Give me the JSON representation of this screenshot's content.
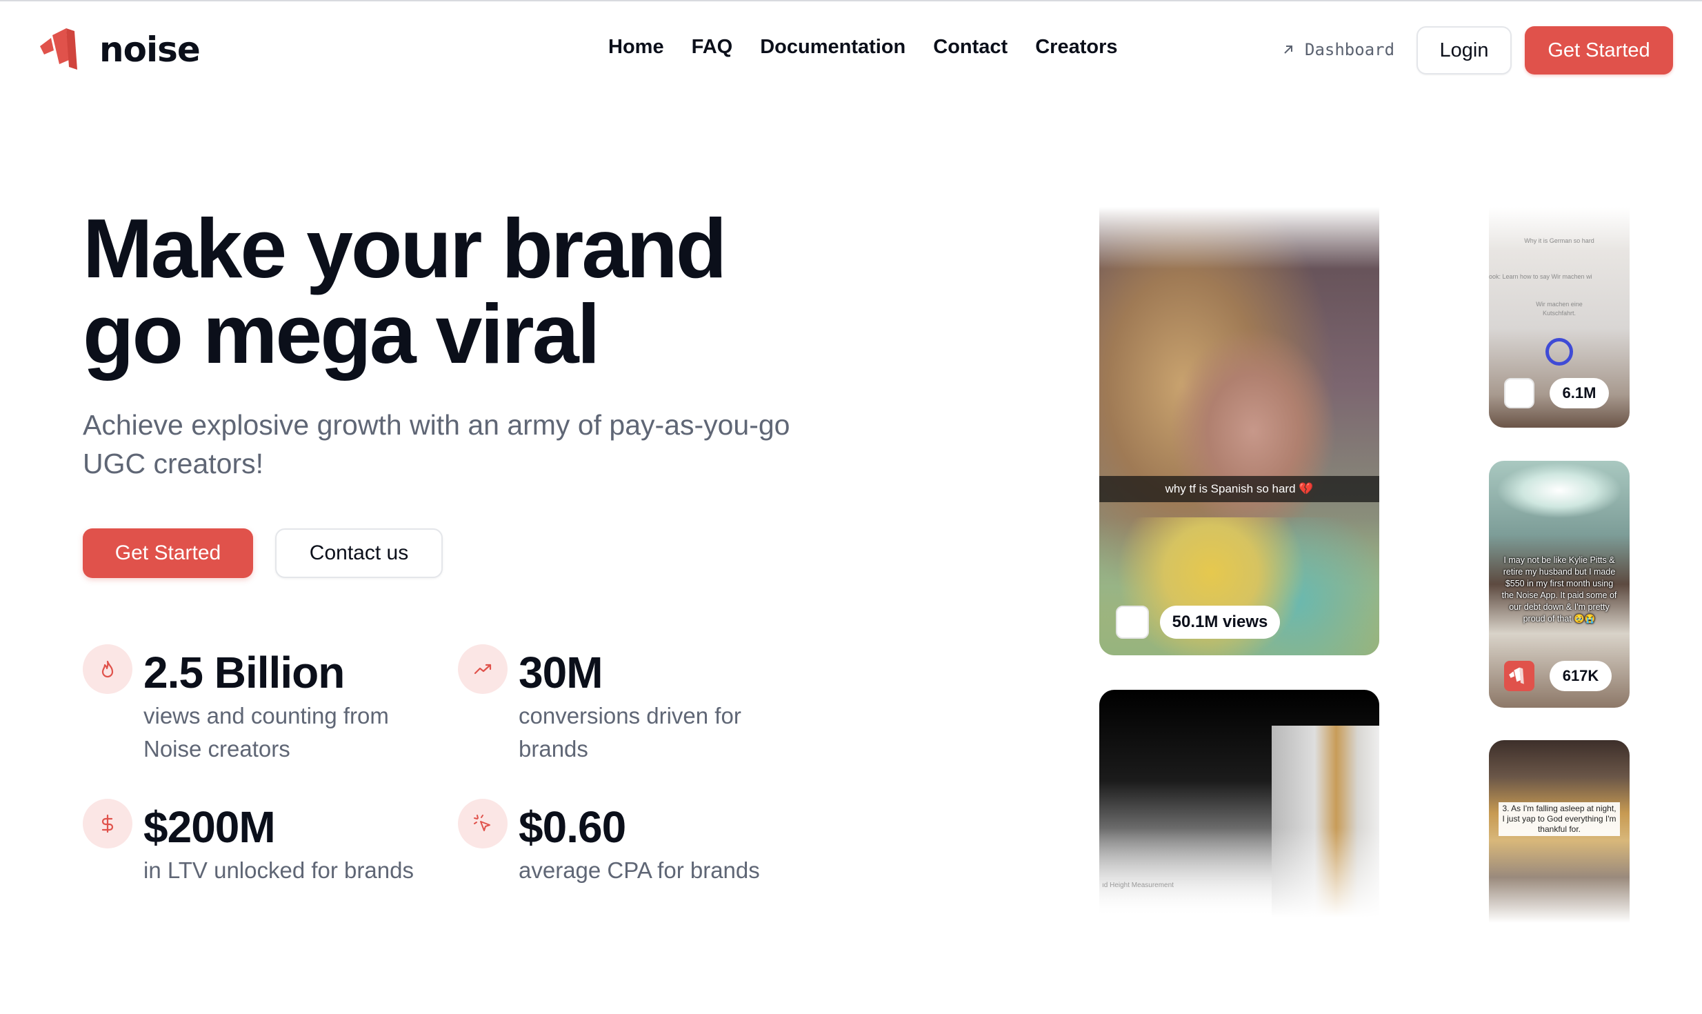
{
  "brand": {
    "name": "noise",
    "accent": "#e0524b"
  },
  "nav": {
    "items": [
      "Home",
      "FAQ",
      "Documentation",
      "Contact",
      "Creators"
    ]
  },
  "header": {
    "dashboard_label": "Dashboard",
    "login_label": "Login",
    "cta_label": "Get Started"
  },
  "hero": {
    "title_line1": "Make your brand",
    "title_line2": "go mega viral",
    "subtitle": "Achieve explosive growth with an army of pay-as-you-go UGC creators!",
    "cta_primary": "Get Started",
    "cta_secondary": "Contact us"
  },
  "stats": [
    {
      "value": "2.5 Billion",
      "description": "views and counting from Noise creators",
      "icon": "flame-icon"
    },
    {
      "value": "30M",
      "description": "conversions driven for brands",
      "icon": "trending-up-icon"
    },
    {
      "value": "$200M",
      "description": "in LTV unlocked for brands",
      "icon": "dollar-icon"
    },
    {
      "value": "$0.60",
      "description": "average CPA for brands",
      "icon": "click-icon"
    }
  ],
  "videos": [
    {
      "caption": "why tf is Spanish so hard 💔",
      "views": "50.1M views"
    },
    {
      "top_text": "Why it is German so hard",
      "line1": "ook: Learn how to say Wir machen wi",
      "line2": "Wir machen eine",
      "line3": "Kutschfahrt.",
      "views": "6.1M"
    },
    {
      "caption": "I may not be like Kylie Pitts & retire my husband but I made $550 in my first month using the Noise App. It paid some of our debt down & I'm pretty proud of that 🥹😭",
      "views": "617K"
    },
    {
      "overlay": "ıd Height Measurement"
    },
    {
      "caption": "3. As I'm falling asleep at night, I just yap to God everything I'm thankful for."
    }
  ]
}
